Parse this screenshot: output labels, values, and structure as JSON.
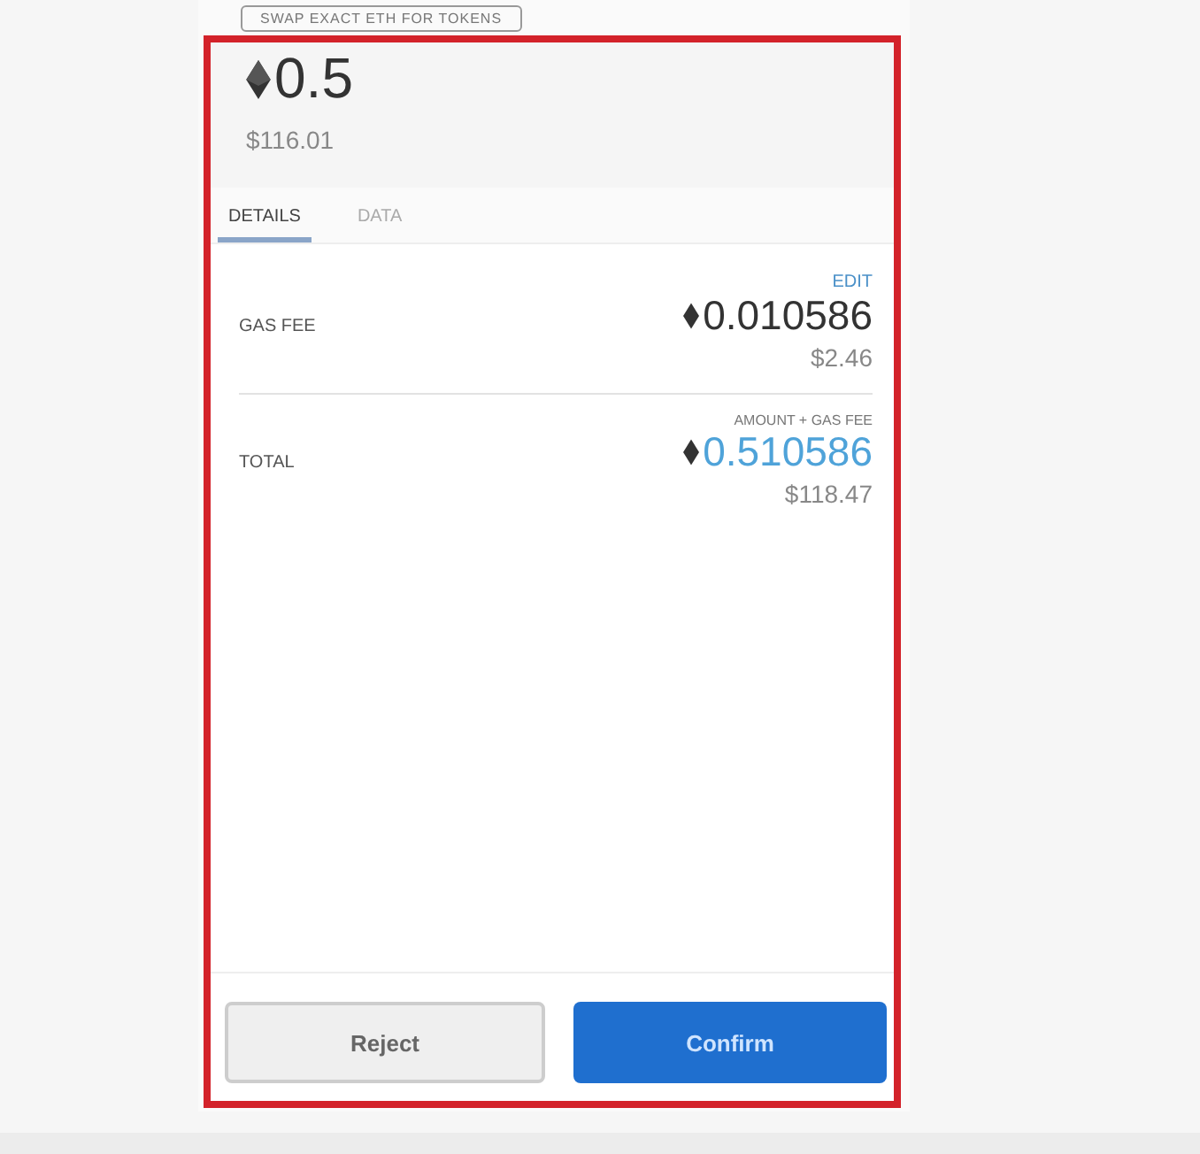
{
  "method_badge": "SWAP EXACT ETH FOR TOKENS",
  "amount": {
    "value": "0.5",
    "fiat": "$116.01"
  },
  "tabs": [
    {
      "label": "DETAILS",
      "selected": true
    },
    {
      "label": "DATA",
      "selected": false
    }
  ],
  "gas_fee": {
    "action": "EDIT",
    "label": "GAS FEE",
    "value": "0.010586",
    "fiat": "$2.46"
  },
  "total": {
    "hint": "AMOUNT + GAS FEE",
    "label": "TOTAL",
    "value": "0.510586",
    "fiat": "$118.47"
  },
  "buttons": [
    {
      "label": "Reject",
      "kind": "secondary"
    },
    {
      "label": "Confirm",
      "kind": "primary"
    }
  ]
}
